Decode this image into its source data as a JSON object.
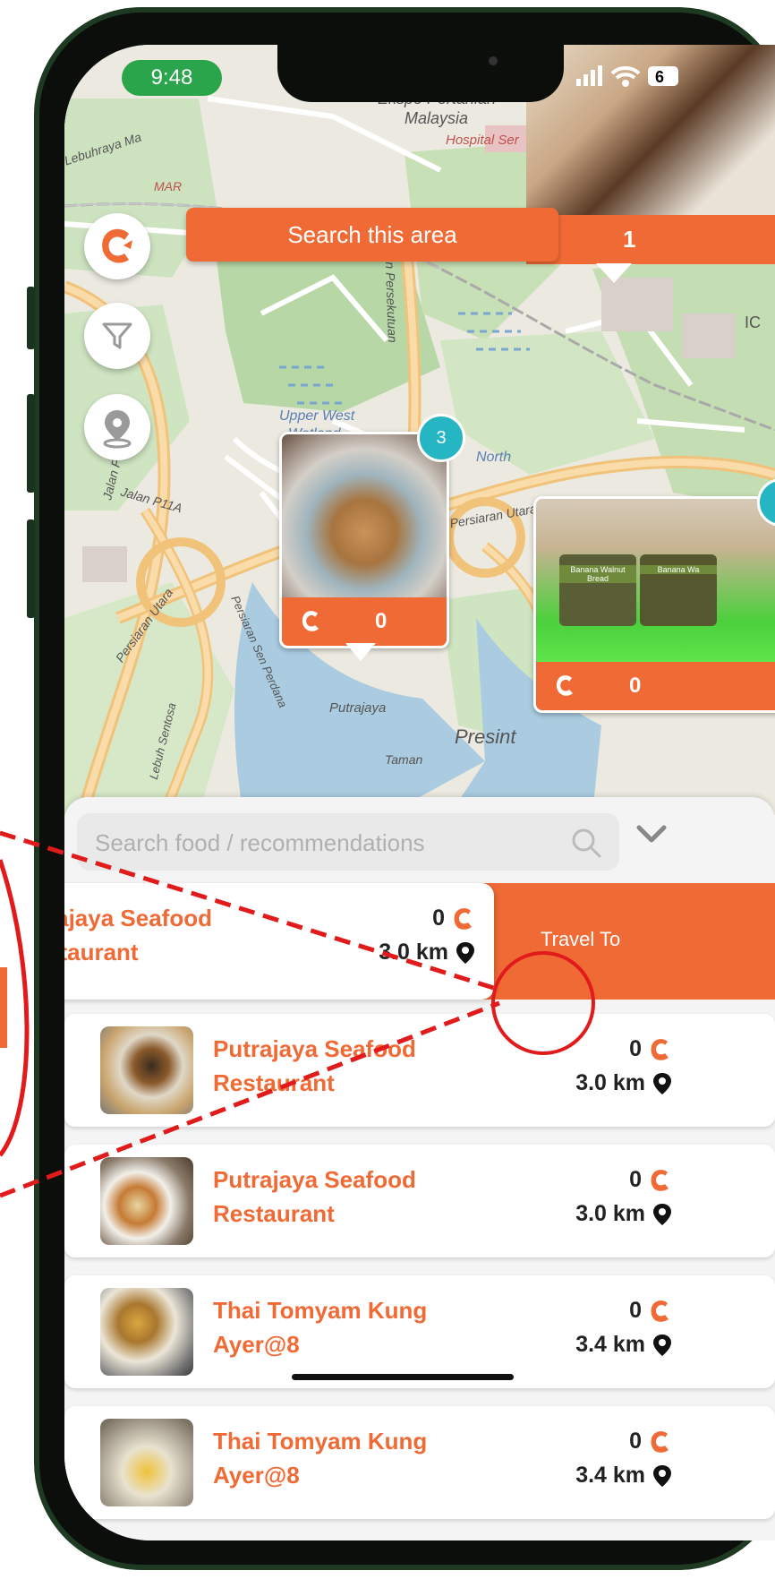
{
  "status_bar": {
    "time": "9:48",
    "battery": "6"
  },
  "map": {
    "labels": {
      "ekspo": "Ekspo Pertanian",
      "malaysia": "Malaysia",
      "hospital": "Hospital Ser",
      "lebuhraya": "Lebuhraya Ma",
      "upper_west": "Upper West",
      "wetland": "Wetland",
      "north": "North",
      "jalan_p11a": "Jalan P11A",
      "jalan_p11": "Jalan P11",
      "persiaran_utara": "Persiaran Utara",
      "persiaran_utara2": "Persiaran Utara",
      "persiaran_sen_perdana": "Persiaran Sen Perdana",
      "persiaran_persekutuan": "Persiaran Persekutuan",
      "putrajaya": "Putrajaya",
      "presint": "Presint",
      "taman": "Taman",
      "sentosa": "Lebuh Sentosa",
      "mar": "MAR",
      "ic": "IC"
    },
    "search_area_label": "Search this area",
    "top_card_count": "1",
    "card1": {
      "badge": "3",
      "count": "0"
    },
    "card2": {
      "count": "0",
      "label1": "Banana Walnut Bread",
      "label2": "Banana Wa"
    }
  },
  "search": {
    "placeholder": "Search food / recommendations"
  },
  "swiped_item": {
    "name_line1": "rajaya Seafood",
    "name_line2": "staurant",
    "count": "0",
    "distance": "3.0 km",
    "action_label": "Travel To"
  },
  "list": [
    {
      "name_line1": "Putrajaya Seafood",
      "name_line2": "Restaurant",
      "count": "0",
      "distance": "3.0 km"
    },
    {
      "name_line1": "Putrajaya Seafood",
      "name_line2": "Restaurant",
      "count": "0",
      "distance": "3.0 km"
    },
    {
      "name_line1": "Thai Tomyam Kung",
      "name_line2": "Ayer@8",
      "count": "0",
      "distance": "3.4 km"
    },
    {
      "name_line1": "Thai Tomyam Kung",
      "name_line2": "Ayer@8",
      "count": "0",
      "distance": "3.4 km"
    }
  ],
  "colors": {
    "accent": "#f06a35",
    "badge": "#26b5c2",
    "time_pill": "#2aa54b",
    "annotation": "#e11b1b"
  },
  "icons": {
    "logo": "c-logo-icon",
    "filter": "filter-icon",
    "location": "location-pin-icon",
    "search": "search-icon",
    "chevron": "chevron-down-icon",
    "distance": "map-marker-icon"
  }
}
